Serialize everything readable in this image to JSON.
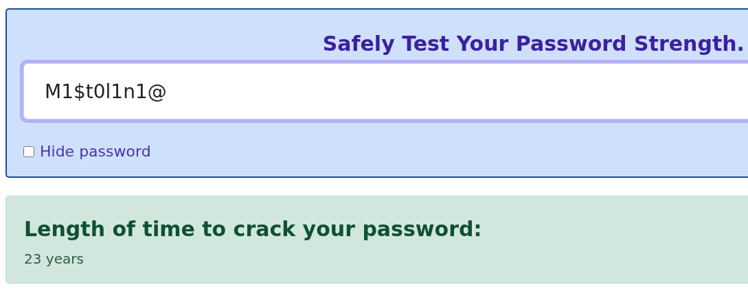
{
  "tester": {
    "title": "Safely Test Your Password Strength.",
    "password_field": {
      "value": "M1$t0l1n1@",
      "focused": true
    },
    "hide_password": {
      "label": "Hide password",
      "checked": false
    }
  },
  "result": {
    "heading": "Length of time to crack your password:",
    "value": "23 years"
  }
}
